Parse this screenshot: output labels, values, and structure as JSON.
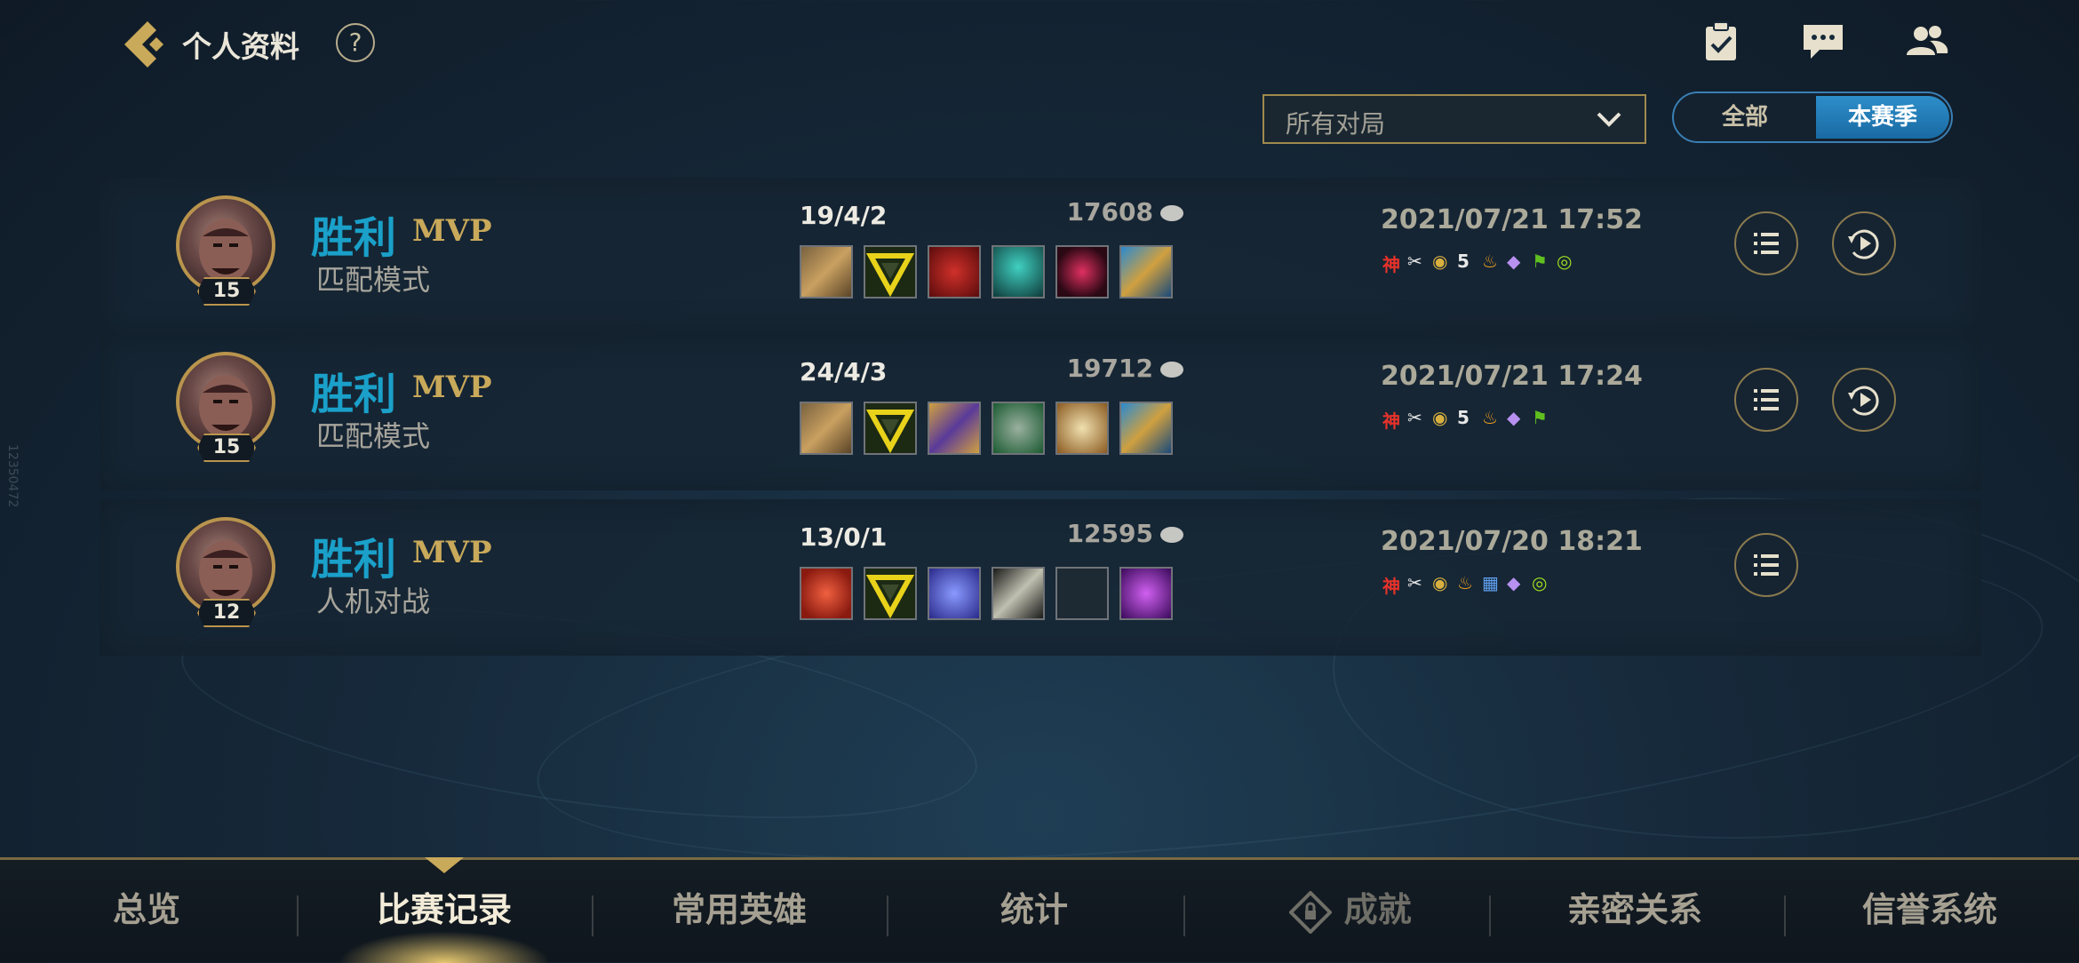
{
  "header": {
    "title": "个人资料",
    "help": "?"
  },
  "filter": {
    "selected": "所有对局"
  },
  "scope_toggle": {
    "all": "全部",
    "season": "本赛季",
    "active": "本赛季"
  },
  "side_id": "12350472",
  "matches": [
    {
      "level": "15",
      "result": "胜利",
      "mvp": "MVP",
      "mode": "匹配模式",
      "kda": "19/4/2",
      "gold": "17608",
      "datetime": "2021/07/21 17:52",
      "items": [
        "gold-armor-item",
        "yellow-triangle-item",
        "red-claw-item",
        "teal-cloak-item",
        "red-gem-item",
        "blue-gold-mech-item"
      ],
      "badges": [
        "神",
        "✂",
        "◉",
        "5",
        "♨",
        "◆",
        "⚑",
        "◎"
      ],
      "has_replay": true
    },
    {
      "level": "15",
      "result": "胜利",
      "mvp": "MVP",
      "mode": "匹配模式",
      "kda": "24/4/3",
      "gold": "19712",
      "datetime": "2021/07/21 17:24",
      "items": [
        "gold-armor-item",
        "yellow-triangle-item",
        "purple-gold-shield-item",
        "green-crystal-item",
        "winged-item",
        "blue-gold-mech-item"
      ],
      "badges": [
        "神",
        "✂",
        "◉",
        "5",
        "♨",
        "◆",
        "⚑"
      ],
      "has_replay": true
    },
    {
      "level": "12",
      "result": "胜利",
      "mvp": "MVP",
      "mode": "人机对战",
      "kda": "13/0/1",
      "gold": "12595",
      "datetime": "2021/07/20 18:21",
      "items": [
        "red-potion-item",
        "yellow-triangle-item",
        "purple-star-item",
        "sword-item",
        "empty-slot",
        "purple-orb-item"
      ],
      "badges": [
        "神",
        "✂",
        "◉",
        "♨",
        "▦",
        "◆",
        "◎"
      ],
      "has_replay": false
    }
  ],
  "bottom_nav": {
    "tabs": [
      "总览",
      "比赛记录",
      "常用英雄",
      "统计",
      "成就",
      "亲密关系",
      "信誉系统"
    ],
    "active_index": 1
  },
  "colors": {
    "win": "#1aa0c9",
    "mvp": "#c9a95a",
    "accent_blue": "#2d8ec9",
    "gold_border": "#b9944d"
  }
}
